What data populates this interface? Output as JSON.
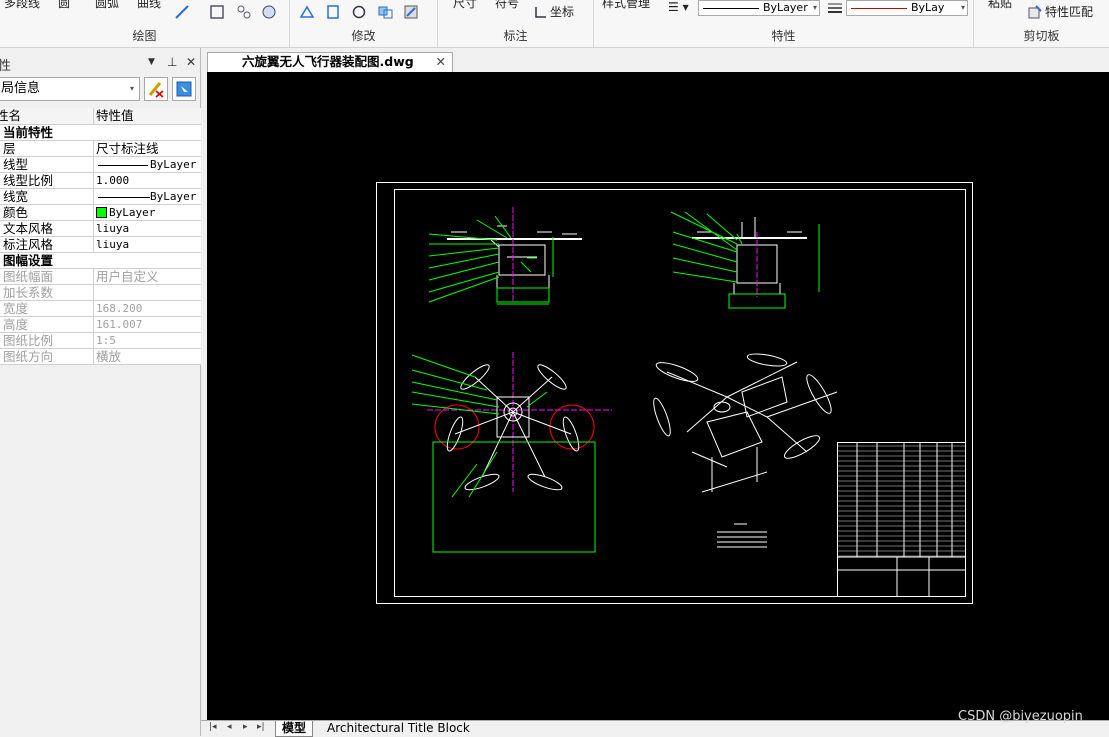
{
  "ribbon": {
    "groups": [
      {
        "title": "绘图",
        "buttons": [
          "多段线",
          "圆",
          "圆弧",
          "曲线"
        ]
      },
      {
        "title": "修改"
      },
      {
        "title": "标注",
        "buttons": [
          "尺寸",
          "符号",
          "坐标"
        ]
      },
      {
        "title": "特性",
        "buttons": [
          "样式管理"
        ],
        "linetype": "ByLayer",
        "lineweight": "ByLay"
      },
      {
        "title": "剪切板",
        "buttons": [
          "粘贴",
          "特性匹配"
        ]
      }
    ]
  },
  "properties_panel": {
    "title": "性",
    "selection": "局信息",
    "columns": [
      "性名",
      "特性值"
    ],
    "sections": [
      {
        "name": "当前特性",
        "rows": [
          {
            "key": "层",
            "value": "尺寸标注线"
          },
          {
            "key": "线型",
            "value": "ByLayer"
          },
          {
            "key": "线型比例",
            "value": "1.000"
          },
          {
            "key": "线宽",
            "value": "ByLayer"
          },
          {
            "key": "颜色",
            "value": "ByLayer",
            "color": "#00ff00"
          },
          {
            "key": "文本风格",
            "value": "liuya"
          },
          {
            "key": "标注风格",
            "value": "liuya"
          }
        ]
      },
      {
        "name": "图幅设置",
        "rows": [
          {
            "key": "图纸幅面",
            "value": "用户自定义"
          },
          {
            "key": "加长系数",
            "value": ""
          },
          {
            "key": "宽度",
            "value": "168.200"
          },
          {
            "key": "高度",
            "value": "161.007"
          },
          {
            "key": "图纸比例",
            "value": "1:5"
          },
          {
            "key": "图纸方向",
            "value": "横放"
          }
        ]
      }
    ]
  },
  "document": {
    "tab_label": "六旋翼无人飞行器装配图.dwg"
  },
  "layout_tabs": [
    "模型",
    "Architectural Title Block"
  ],
  "watermark": "CSDN @biyezuopin",
  "colors": {
    "canvas": "#000000",
    "annotation": "#00ff00",
    "drawing": "#ffffff",
    "centerline": "#ff00ff",
    "circle": "#ff0000"
  }
}
